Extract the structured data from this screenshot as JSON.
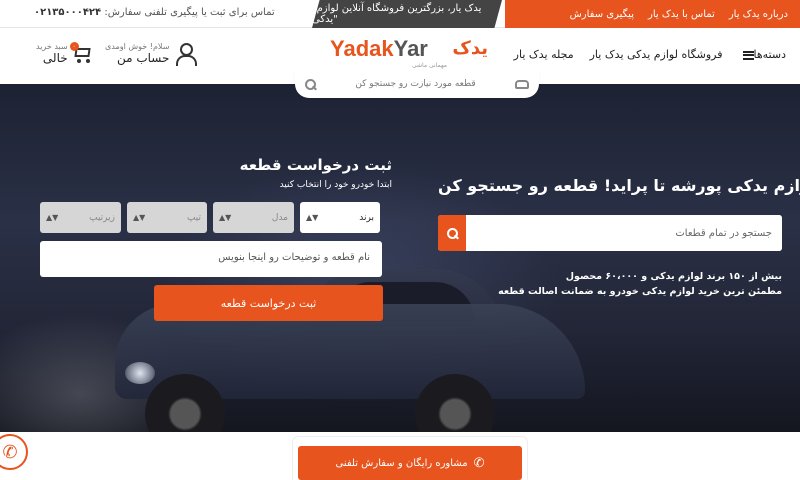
{
  "topbar": {
    "links": [
      "درباره یدک یار",
      "تماس با یدک یار",
      "پیگیری سفارش"
    ],
    "slogan": "\"یدک یار، بزرگترین فروشگاه آنلاین لوازم یدکی\"",
    "phone_label": "تماس برای ثبت یا پیگیری تلفنی سفارش:",
    "phone_number": "۰۲۱۳۵۰۰۰۴۲۴"
  },
  "header": {
    "menu": [
      "دسته‌ها",
      "فروشگاه لوازم یدکی یدک یار",
      "مجله یدک یار"
    ],
    "logo_latin_1": "Yadak",
    "logo_latin_2": "Yar",
    "logo_persian": "یدک",
    "logo_tag": "مهمانی ماشی",
    "account_greeting": "سلام! خوش اومدی",
    "account_label": "حساب من",
    "cart_label": "سبد خرید",
    "cart_status": "خالی",
    "cart_count": "۰",
    "search_placeholder": "قطعه مورد نیازت رو جستجو کن"
  },
  "hero": {
    "headline": "لوازم یدکی پورشه تا پراید! قطعه رو جستجو کن:",
    "search_placeholder": "جستجو در تمام قطعات",
    "stat_line_1": "بیش از ۱۵۰ برند لوازم یدکی و ۶۰،۰۰۰ محصول",
    "stat_line_2": "مطمئن ترین خرید لوازم یدکی خودرو به ضمانت اصالت قطعه"
  },
  "request_form": {
    "title": "ثبت درخواست قطعه",
    "subtitle": "ابتدا خودرو خود را انتخاب کنید",
    "selects": [
      "برند",
      "مدل",
      "تیپ",
      "زیرتیپ"
    ],
    "part_placeholder": "نام قطعه و توضیحات رو اینجا بنویس",
    "submit_label": "ثبت درخواست قطعه"
  },
  "bottom": {
    "consult_label": "مشاوره رایگان و سفارش تلفنی"
  },
  "colors": {
    "accent": "#e8541e",
    "dark_strip": "#444444"
  }
}
